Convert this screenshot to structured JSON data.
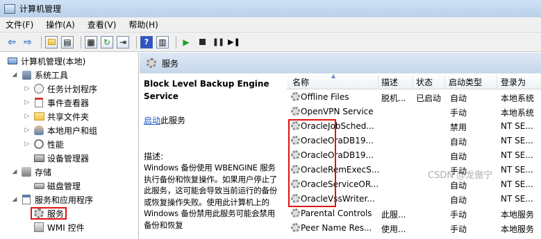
{
  "window": {
    "title": "计算机管理"
  },
  "menu": [
    "文件(F)",
    "操作(A)",
    "查看(V)",
    "帮助(H)"
  ],
  "toolbar_icons": [
    "back-arrow-icon",
    "forward-arrow-icon",
    "folder-up-icon",
    "show-hide-tree-icon",
    "properties-icon",
    "refresh-icon",
    "export-icon",
    "help-icon",
    "view-icon",
    "start-service-icon",
    "stop-service-icon",
    "pause-service-icon",
    "restart-service-icon"
  ],
  "tree": [
    {
      "label": "计算机管理(本地)",
      "icon": "computer-icon",
      "level": 0,
      "twisty": ""
    },
    {
      "label": "系统工具",
      "icon": "tools-icon",
      "level": 1,
      "twisty": "◢"
    },
    {
      "label": "任务计划程序",
      "icon": "clock-icon",
      "level": 2,
      "twisty": "▷"
    },
    {
      "label": "事件查看器",
      "icon": "event-log-icon",
      "level": 2,
      "twisty": "▷"
    },
    {
      "label": "共享文件夹",
      "icon": "shared-folder-icon",
      "level": 2,
      "twisty": "▷"
    },
    {
      "label": "本地用户和组",
      "icon": "users-icon",
      "level": 2,
      "twisty": "▷"
    },
    {
      "label": "性能",
      "icon": "performance-icon",
      "level": 2,
      "twisty": "▷"
    },
    {
      "label": "设备管理器",
      "icon": "device-manager-icon",
      "level": 2,
      "twisty": ""
    },
    {
      "label": "存储",
      "icon": "storage-icon",
      "level": 1,
      "twisty": "◢"
    },
    {
      "label": "磁盘管理",
      "icon": "disk-icon",
      "level": 2,
      "twisty": ""
    },
    {
      "label": "服务和应用程序",
      "icon": "apps-icon",
      "level": 1,
      "twisty": "◢"
    },
    {
      "label": "服务",
      "icon": "gear-icon",
      "level": 2,
      "twisty": "",
      "selected": true
    },
    {
      "label": "WMI 控件",
      "icon": "wmi-icon",
      "level": 2,
      "twisty": ""
    }
  ],
  "content": {
    "header": "服务",
    "selected_service": "Block Level Backup Engine Service",
    "start_link": "启动",
    "start_suffix": "此服务",
    "desc_label": "描述:",
    "description": "Windows 备份使用 WBENGINE 服务执行备份和恢复操作。如果用户停止了此服务，这可能会导致当前运行的备份或恢复操作失败。使用此计算机上的 Windows 备份禁用此服务可能会禁用备份和恢复"
  },
  "list": {
    "columns": [
      "名称",
      "描述",
      "状态",
      "启动类型",
      "登录为"
    ],
    "rows": [
      {
        "name": "Offline Files",
        "desc": "脱机...",
        "status": "已启动",
        "startup": "自动",
        "logon": "本地系统"
      },
      {
        "name": "OpenVPN Service",
        "desc": "",
        "status": "",
        "startup": "手动",
        "logon": "本地系统"
      },
      {
        "name": "OracleJobSched...",
        "desc": "",
        "status": "",
        "startup": "禁用",
        "logon": "NT SE..."
      },
      {
        "name": "OracleOraDB19...",
        "desc": "",
        "status": "",
        "startup": "自动",
        "logon": "NT SE..."
      },
      {
        "name": "OracleOraDB19...",
        "desc": "",
        "status": "",
        "startup": "自动",
        "logon": "NT SE..."
      },
      {
        "name": "OracleRemExecS...",
        "desc": "",
        "status": "",
        "startup": "手动",
        "logon": "NT SE..."
      },
      {
        "name": "OracleServiceOR...",
        "desc": "",
        "status": "",
        "startup": "自动",
        "logon": "NT SE..."
      },
      {
        "name": "OracleVssWriter...",
        "desc": "",
        "status": "",
        "startup": "自动",
        "logon": "NT SE..."
      },
      {
        "name": "Parental Controls",
        "desc": "此服...",
        "status": "",
        "startup": "手动",
        "logon": "本地服务"
      },
      {
        "name": "Peer Name Res...",
        "desc": "使用...",
        "status": "",
        "startup": "手动",
        "logon": "本地服务"
      }
    ]
  },
  "watermark": "CSDN @龙傲宁"
}
